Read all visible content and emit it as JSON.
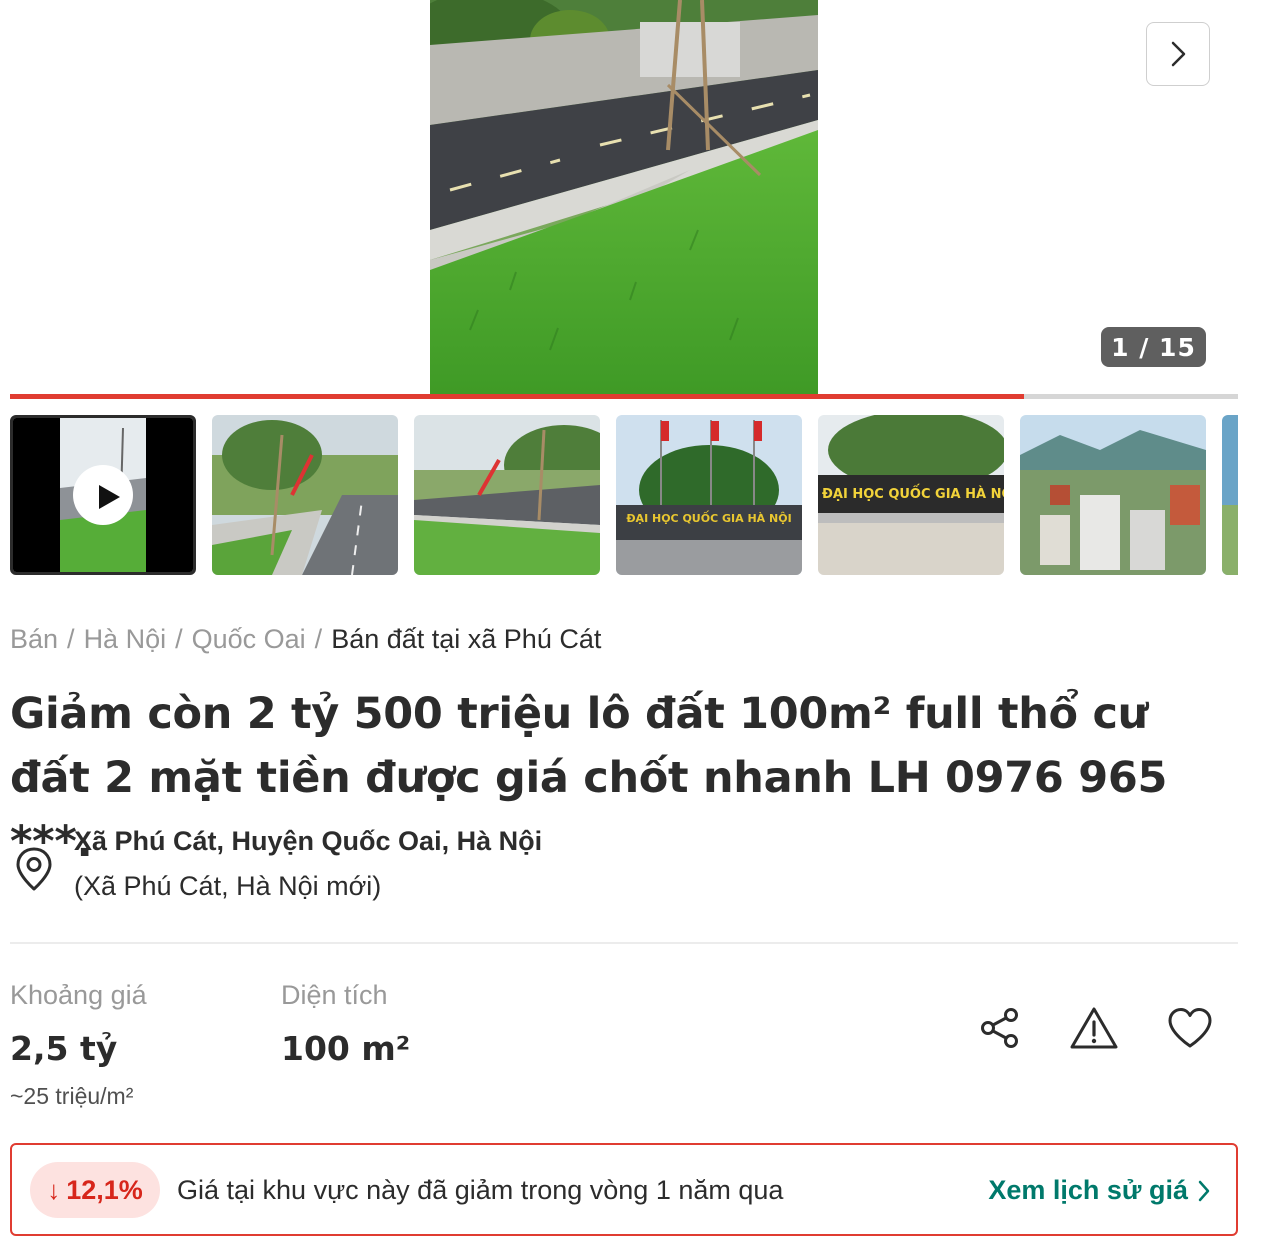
{
  "gallery": {
    "counter": "1 / 15",
    "progress": 0.826,
    "thumbnails": [
      {
        "kind": "video",
        "banner": ""
      },
      {
        "kind": "photo",
        "banner": ""
      },
      {
        "kind": "photo",
        "banner": ""
      },
      {
        "kind": "photo",
        "banner": "ĐẠI HỌC QUỐC GIA HÀ NỘI"
      },
      {
        "kind": "photo",
        "banner": "ĐẠI HỌC QUỐC GIA HÀ NỘI"
      },
      {
        "kind": "photo",
        "banner": ""
      },
      {
        "kind": "photo",
        "banner": ""
      }
    ]
  },
  "breadcrumb": {
    "items": [
      "Bán",
      "Hà Nội",
      "Quốc Oai"
    ],
    "separator": "/",
    "current": "Bán đất tại xã Phú Cát"
  },
  "listing": {
    "title": "Giảm còn 2 tỷ 500 triệu lô đất 100m² full thổ cư đất 2 mặt tiền được giá chốt nhanh LH 0976 965 ***.",
    "address_line1": "Xã Phú Cát, Huyện Quốc Oai, Hà Nội",
    "address_line2": "(Xã Phú Cát, Hà Nội mới)"
  },
  "specs": {
    "price_label": "Khoảng giá",
    "price_value": "2,5 tỷ",
    "price_per_m2": "~25 triệu/m²",
    "area_label": "Diện tích",
    "area_value": "100 m²"
  },
  "actions": [
    "share-icon",
    "report-warning-icon",
    "heart-icon"
  ],
  "trend": {
    "percent": "12,1%",
    "text": "Giá tại khu vực này đã giảm trong vòng 1 năm qua",
    "link": "Xem lịch sử giá"
  },
  "colors": {
    "accent_red": "#e03c31",
    "link_teal": "#00796b",
    "badge_bg": "#fde2e0"
  }
}
